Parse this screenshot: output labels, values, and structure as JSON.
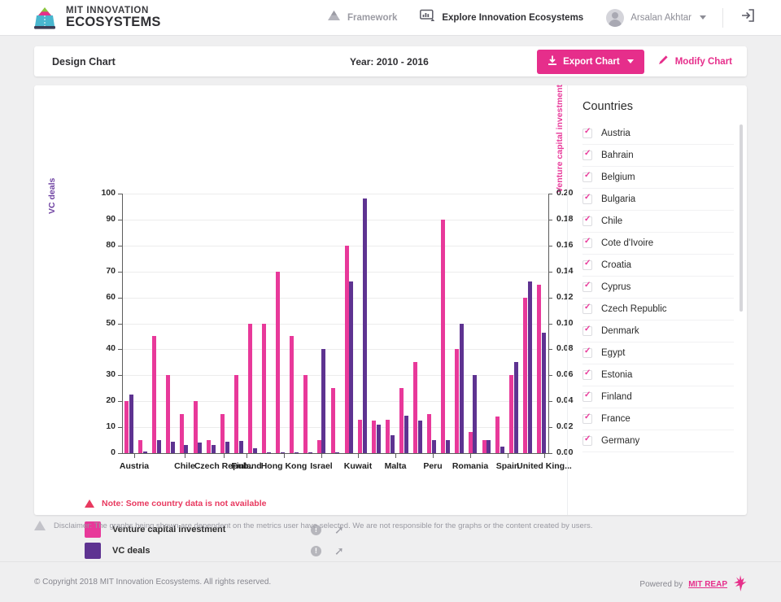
{
  "header": {
    "brand_line1": "MIT INNOVATION",
    "brand_line2": "ECOSYSTEMS",
    "nav": [
      {
        "label": "Framework",
        "icon": "pyramid-icon",
        "active": false
      },
      {
        "label": "Explore Innovation Ecosystems",
        "icon": "monitor-chart-icon",
        "active": true
      }
    ],
    "user_name": "Arsalan Akhtar",
    "logout_icon": "logout-icon"
  },
  "toolbar": {
    "title": "Design Chart",
    "year_label": "Year: 2010 - 2016",
    "export_label": "Export Chart",
    "export_icon": "download-icon",
    "modify_label": "Modify Chart",
    "modify_icon": "pencil-icon",
    "accent_color": "#e62e8b"
  },
  "note": {
    "icon": "warning-triangle-icon",
    "text": "Note: Some country data is not available"
  },
  "legend": [
    {
      "label": "Venture capital investment",
      "color": "#e8399a",
      "info_icon": "info-icon",
      "share_icon": "share-icon"
    },
    {
      "label": "VC deals",
      "color": "#5e3391",
      "info_icon": "info-icon",
      "share_icon": "share-icon"
    }
  ],
  "countries_panel": {
    "title": "Countries",
    "items": [
      {
        "label": "Austria",
        "checked": true
      },
      {
        "label": "Bahrain",
        "checked": true
      },
      {
        "label": "Belgium",
        "checked": true
      },
      {
        "label": "Bulgaria",
        "checked": true
      },
      {
        "label": "Chile",
        "checked": true
      },
      {
        "label": "Cote d'Ivoire",
        "checked": true
      },
      {
        "label": "Croatia",
        "checked": true
      },
      {
        "label": "Cyprus",
        "checked": true
      },
      {
        "label": "Czech Republic",
        "checked": true
      },
      {
        "label": "Denmark",
        "checked": true
      },
      {
        "label": "Egypt",
        "checked": true
      },
      {
        "label": "Estonia",
        "checked": true
      },
      {
        "label": "Finland",
        "checked": true
      },
      {
        "label": "France",
        "checked": true
      },
      {
        "label": "Germany",
        "checked": true
      }
    ]
  },
  "disclaimer": {
    "icon": "warning-triangle-icon",
    "text": "Disclaimer: The graphs being shown are dependent on the metrics user have selected. We are not responsible for the graphs or the content created by users."
  },
  "footer": {
    "copyright": "© Copyright 2018 MIT Innovation Ecosystems. All rights reserved.",
    "powered_prefix": "Powered by",
    "powered_link": "MIT REAP"
  },
  "chart_data": {
    "type": "bar",
    "title": "",
    "xlabel": "",
    "ylabel": "VC deals",
    "y2label": "Venture capital investment",
    "ylim": [
      0,
      100
    ],
    "y2lim": [
      0,
      0.2
    ],
    "yticks": [
      0,
      10,
      20,
      30,
      40,
      50,
      60,
      70,
      80,
      90,
      100
    ],
    "y2ticks": [
      "0.00",
      "0.02",
      "0.04",
      "0.06",
      "0.08",
      "0.10",
      "0.12",
      "0.14",
      "0.16",
      "0.18",
      "0.20"
    ],
    "grid": true,
    "legend_position": "below",
    "xtick_labels": [
      "Austria",
      "Chile",
      "Czech Repub..",
      "Finland",
      "Hong Kong",
      "Israel",
      "Kuwait",
      "Malta",
      "Peru",
      "Romania",
      "Spain",
      "United King..."
    ],
    "series": [
      {
        "name": "Venture capital investment",
        "color": "#e8399a",
        "axis": "right",
        "values_right_axis": [
          0.04,
          0.09,
          0.06,
          0.01,
          0.03,
          0.04,
          0.01,
          0.03,
          0.06,
          0.1,
          0.1,
          0.14,
          0.09,
          0.06,
          0.01,
          0.002,
          0.02,
          0.002,
          0.01,
          0.026,
          0.16,
          0.03,
          0.006,
          0.002,
          0.006,
          0.03,
          0.014,
          0.182,
          0.05,
          0.08,
          0.01,
          0.016,
          0.024,
          0.05,
          0.07,
          0.028,
          0.002,
          0.012,
          0.03,
          0.06,
          0.07,
          0.12,
          0.13
        ]
      },
      {
        "name": "VC deals",
        "color": "#5e3391",
        "axis": "left",
        "values_left_axis": [
          22.5,
          0.5,
          5,
          0.4,
          4.5,
          3,
          4,
          3,
          0.5,
          0.4,
          1.8,
          0.4,
          4.8,
          0.4,
          0.4,
          40,
          25,
          0.4,
          13,
          98,
          12.5,
          11,
          13,
          7,
          0.4,
          14.5,
          12.5,
          0.4,
          0.4,
          30,
          0.4,
          8,
          5,
          0.4,
          0.4,
          25,
          0.4,
          2.5,
          0.4,
          1.5,
          66,
          13,
          46.5
        ]
      }
    ],
    "pairs": [
      {
        "pink": 20,
        "purple": 22.5
      },
      {
        "pink": 5,
        "purple": 0.5
      },
      {
        "pink": 45,
        "purple": 5
      },
      {
        "pink": 30,
        "purple": 4.5
      },
      {
        "pink": 15,
        "purple": 3
      },
      {
        "pink": 20,
        "purple": 4
      },
      {
        "pink": 5,
        "purple": 3
      },
      {
        "pink": 15,
        "purple": 4.5
      },
      {
        "pink": 30,
        "purple": 4.8
      },
      {
        "pink": 50,
        "purple": 1.8
      },
      {
        "pink": 50,
        "purple": 0.4
      },
      {
        "pink": 70,
        "purple": 0.4
      },
      {
        "pink": 45,
        "purple": 0.4
      },
      {
        "pink": 30,
        "purple": 0.4
      },
      {
        "pink": 5,
        "purple": 40
      },
      {
        "pink": 25,
        "purple": 0.4
      },
      {
        "pink": 80,
        "purple": 66
      },
      {
        "pink": 13,
        "purple": 98
      },
      {
        "pink": 12.5,
        "purple": 11
      },
      {
        "pink": 13,
        "purple": 7
      },
      {
        "pink": 25,
        "purple": 14.5
      },
      {
        "pink": 35,
        "purple": 12.5
      },
      {
        "pink": 15,
        "purple": 5
      },
      {
        "pink": 90,
        "purple": 5
      },
      {
        "pink": 40,
        "purple": 50
      },
      {
        "pink": 8,
        "purple": 30
      },
      {
        "pink": 5,
        "purple": 5
      },
      {
        "pink": 14,
        "purple": 2.5
      },
      {
        "pink": 30,
        "purple": 35
      },
      {
        "pink": 60,
        "purple": 66
      },
      {
        "pink": 65,
        "purple": 46.5
      }
    ]
  }
}
